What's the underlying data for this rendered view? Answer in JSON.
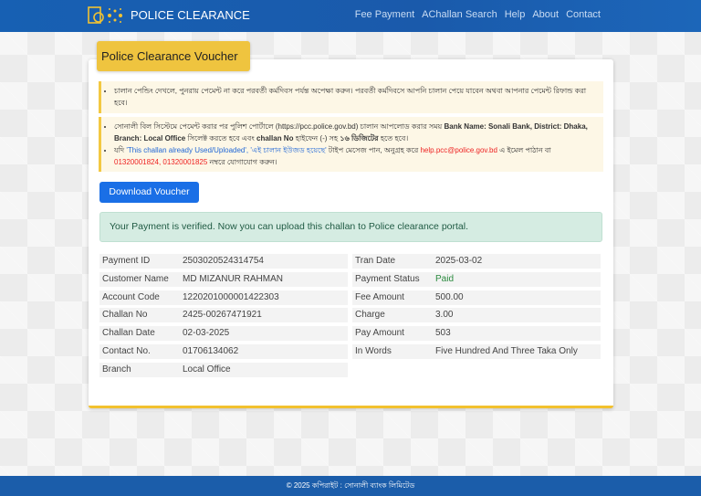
{
  "header": {
    "brand": "POLICE CLEARANCE",
    "menu": [
      "Fee Payment",
      "AChallan Search",
      "Help",
      "About",
      "Contact"
    ]
  },
  "card": {
    "title": "Police Clearance Voucher",
    "notes": {
      "n1": "চালান পেন্ডিং দেখলে, পুনরায় পেমেন্ট না করে পরবর্তী কর্মদিবস পর্যন্ত অপেক্ষা করুন। পরবর্তী কর্মদিবসে আপনি চালান পেয়ে যাবেন অথবা আপনার পেমেন্ট রিফান্ড করা হবে।",
      "n2a": "সোনালী বিল সিস্টেমে পেমেন্ট করার পর পুলিশ পোর্টালে (https://pcc.police.gov.bd) চালান আপলোড করার সময় ",
      "n2b": "Bank Name: Sonali Bank, District: Dhaka, Branch: Local Office",
      "n2c": " সিলেক্ট করতে হবে এবং ",
      "n2d": "challan No",
      "n2e": " হাইফেন (-) সহ ",
      "n2f": "১৬ ডিজিটের",
      "n2g": " হতে হবে।",
      "n3a": "যদি ",
      "n3b": "'This challan already Used/Uploaded', 'এই চালান ইউজড হয়েছে'",
      "n3c": " টাইপ মেসেজ পান, অনুগ্রহ করে ",
      "n3d": "help.pcc@police.gov.bd",
      "n3e": " এ ইমেল পাঠান বা ",
      "n3f": "01320001824, 01320001825",
      "n3g": " নম্বরে যোগাযোগ করুন।"
    },
    "download_label": "Download Voucher",
    "success": "Your Payment is verified. Now you can upload this challan to Police clearance portal.",
    "left": [
      [
        "Payment ID",
        "2503020524314754"
      ],
      [
        "Customer Name",
        "MD MIZANUR RAHMAN"
      ],
      [
        "Account Code",
        "1220201000001422303"
      ],
      [
        "Challan No",
        "2425-00267471921"
      ],
      [
        "Challan Date",
        "02-03-2025"
      ],
      [
        "Contact No.",
        "01706134062"
      ],
      [
        "Branch",
        "Local Office"
      ]
    ],
    "right": [
      [
        "Tran Date",
        "2025-03-02"
      ],
      [
        "Payment Status",
        "Paid"
      ],
      [
        "Fee Amount",
        "500.00"
      ],
      [
        "Charge",
        "3.00"
      ],
      [
        "Pay Amount",
        "503"
      ],
      [
        "In Words",
        "Five Hundred And Three Taka Only"
      ]
    ]
  },
  "footer": "© 2025 কপিরাইট : সোনালী ব্যাংক লিমিটেড",
  "colors": {
    "nav": "#1a5aab",
    "accent": "#efc43f",
    "button": "#1a6fe6",
    "paid": "#2a8a3e"
  }
}
